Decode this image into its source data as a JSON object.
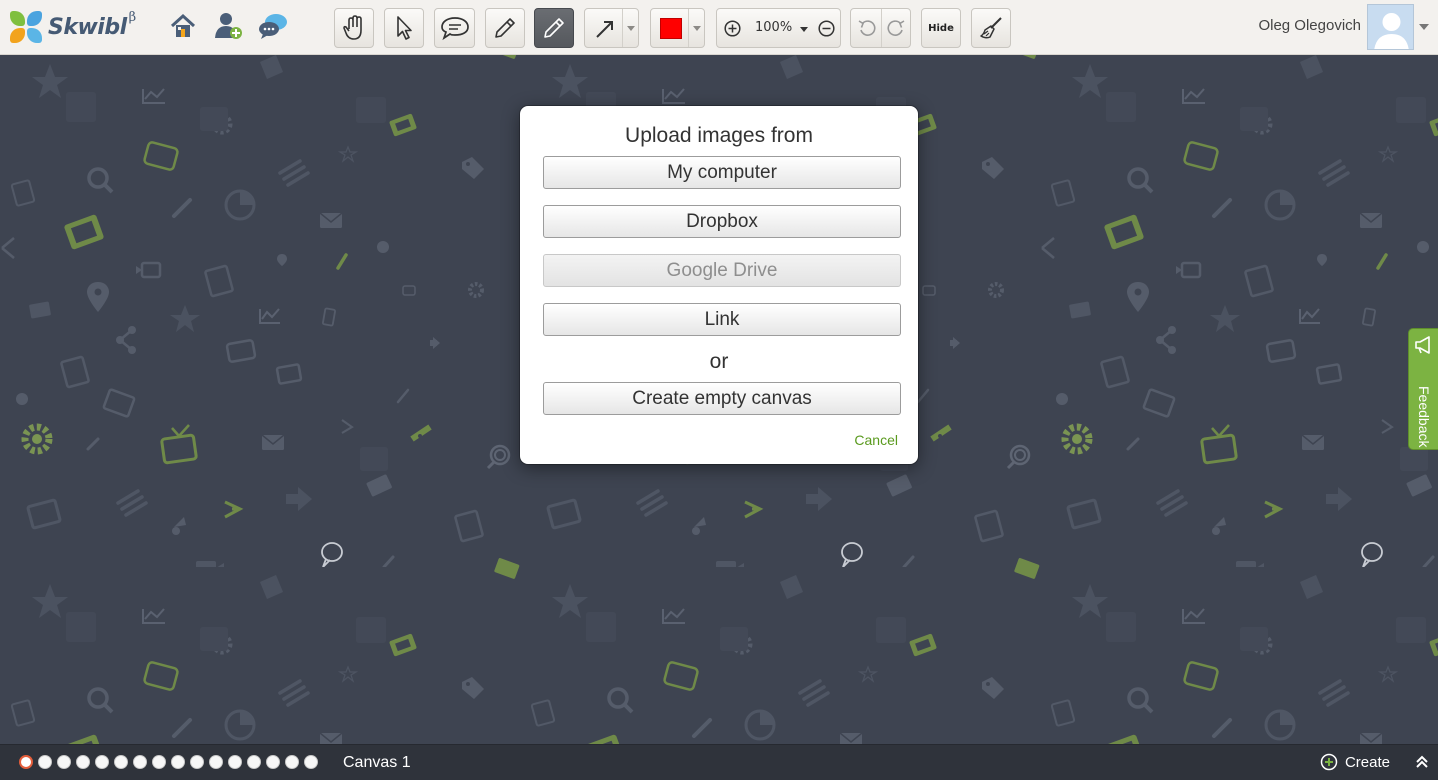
{
  "app": {
    "name": "Skwibl",
    "beta_mark": "β"
  },
  "toolbar": {
    "nav_icons": [
      "home-icon",
      "add-user-icon",
      "chat-icon"
    ],
    "tools": [
      "hand-icon",
      "pointer-icon",
      "comment-icon",
      "pencil-icon",
      "pen-icon",
      "arrow-icon"
    ],
    "active_tool": "pen-icon",
    "color": "#ff0000",
    "zoom": "100%",
    "hide_label": "Hide"
  },
  "user": {
    "name": "Oleg Olegovich"
  },
  "dialog": {
    "title": "Upload images from",
    "options": {
      "my_computer": "My computer",
      "dropbox": "Dropbox",
      "google_drive": "Google Drive",
      "link": "Link"
    },
    "or_label": "or",
    "create_empty": "Create empty canvas",
    "cancel": "Cancel"
  },
  "feedback": {
    "label": "Feedback"
  },
  "bottombar": {
    "canvas_count": 16,
    "current_canvas": 1,
    "canvas_label": "Canvas 1",
    "create_label": "Create"
  },
  "colors": {
    "accent_green": "#7cb342",
    "cancel_green": "#5a9a1e",
    "canvas_bg": "#3e4451",
    "brand_blue": "#455a74"
  }
}
